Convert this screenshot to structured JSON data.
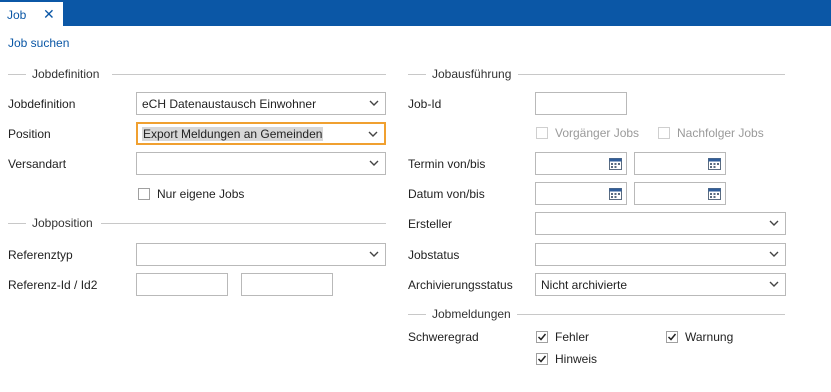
{
  "tabs": [
    {
      "label": "Job",
      "close_icon": "close-icon"
    }
  ],
  "link": {
    "search_job": "Job suchen"
  },
  "sections": {
    "jobdefinition": "Jobdefinition",
    "jobposition": "Jobposition",
    "jobausfuehrung": "Jobausführung",
    "jobmeldungen": "Jobmeldungen"
  },
  "left": {
    "jobdefinition": {
      "label": "Jobdefinition",
      "value": "eCH Datenaustausch Einwohner"
    },
    "position": {
      "label": "Position",
      "value": "Export Meldungen an Gemeinden"
    },
    "versandart": {
      "label": "Versandart",
      "value": ""
    },
    "nur_eigene": {
      "label": "Nur eigene Jobs",
      "checked": false
    },
    "referenztyp": {
      "label": "Referenztyp",
      "value": ""
    },
    "referenz_id": {
      "label": "Referenz-Id / Id2",
      "value1": "",
      "value2": ""
    }
  },
  "right": {
    "job_id": {
      "label": "Job-Id",
      "value": ""
    },
    "vorgaenger": {
      "label": "Vorgänger Jobs",
      "checked": false
    },
    "nachfolger": {
      "label": "Nachfolger Jobs",
      "checked": false
    },
    "termin": {
      "label": "Termin von/bis"
    },
    "datum": {
      "label": "Datum von/bis"
    },
    "ersteller": {
      "label": "Ersteller",
      "value": ""
    },
    "jobstatus": {
      "label": "Jobstatus",
      "value": ""
    },
    "archivierung": {
      "label": "Archivierungsstatus",
      "value": "Nicht archivierte"
    },
    "schweregrad": {
      "label": "Schweregrad",
      "fehler": {
        "label": "Fehler",
        "checked": true
      },
      "warnung": {
        "label": "Warnung",
        "checked": true
      },
      "hinweis": {
        "label": "Hinweis",
        "checked": true
      }
    }
  },
  "colors": {
    "accent": "#0b57a6",
    "focus": "#f0a030"
  }
}
